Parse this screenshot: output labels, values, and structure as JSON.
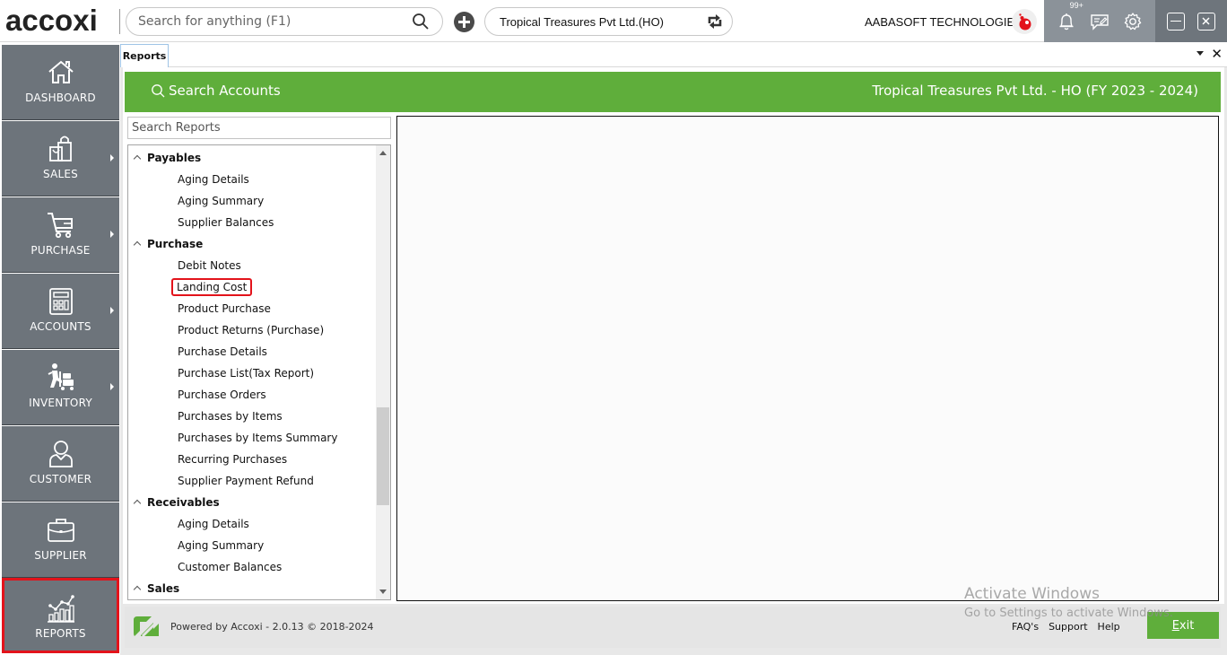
{
  "app": {
    "logo_text": "accoxi",
    "global_search": {
      "placeholder": "Search for anything (F1)",
      "value": ""
    },
    "company_selector": {
      "value": "Tropical Treasures Pvt Ltd.(HO)"
    },
    "organization": {
      "name": "AABASOFT TECHNOLOGIES"
    },
    "notifications": {
      "badge": "99+"
    }
  },
  "sidebar": {
    "items": [
      {
        "label": "DASHBOARD",
        "icon": "house-icon",
        "has_submenu": false,
        "selected": false
      },
      {
        "label": "SALES",
        "icon": "shopping-bags-icon",
        "has_submenu": true,
        "selected": false
      },
      {
        "label": "PURCHASE",
        "icon": "shopping-cart-icon",
        "has_submenu": true,
        "selected": false
      },
      {
        "label": "ACCOUNTS",
        "icon": "calculator-icon",
        "has_submenu": true,
        "selected": false
      },
      {
        "label": "INVENTORY",
        "icon": "person-with-trolley-icon",
        "has_submenu": true,
        "selected": false
      },
      {
        "label": "CUSTOMER",
        "icon": "person-icon",
        "has_submenu": false,
        "selected": false
      },
      {
        "label": "SUPPLIER",
        "icon": "briefcase-icon",
        "has_submenu": false,
        "selected": false
      },
      {
        "label": "REPORTS",
        "icon": "chart-icon",
        "has_submenu": false,
        "selected": true
      }
    ]
  },
  "tabs": [
    {
      "label": "Reports",
      "active": true
    }
  ],
  "header": {
    "search_accounts_label": "Search Accounts",
    "company_fy": "Tropical Treasures Pvt Ltd. - HO (FY 2023 - 2024)"
  },
  "reports": {
    "search": {
      "placeholder": "Search Reports",
      "value": ""
    },
    "tree": [
      {
        "type": "group",
        "label": "Payables"
      },
      {
        "type": "leaf",
        "label": "Aging Details"
      },
      {
        "type": "leaf",
        "label": "Aging Summary"
      },
      {
        "type": "leaf",
        "label": "Supplier Balances"
      },
      {
        "type": "group",
        "label": "Purchase"
      },
      {
        "type": "leaf",
        "label": "Debit Notes"
      },
      {
        "type": "leaf",
        "label": "Landing Cost",
        "highlighted": true
      },
      {
        "type": "leaf",
        "label": "Product Purchase"
      },
      {
        "type": "leaf",
        "label": "Product Returns (Purchase)"
      },
      {
        "type": "leaf",
        "label": "Purchase Details"
      },
      {
        "type": "leaf",
        "label": "Purchase List(Tax Report)"
      },
      {
        "type": "leaf",
        "label": "Purchase Orders"
      },
      {
        "type": "leaf",
        "label": "Purchases by Items"
      },
      {
        "type": "leaf",
        "label": "Purchases by Items Summary"
      },
      {
        "type": "leaf",
        "label": "Recurring Purchases"
      },
      {
        "type": "leaf",
        "label": "Supplier Payment Refund"
      },
      {
        "type": "group",
        "label": "Receivables"
      },
      {
        "type": "leaf",
        "label": "Aging Details"
      },
      {
        "type": "leaf",
        "label": "Aging Summary"
      },
      {
        "type": "leaf",
        "label": "Customer Balances"
      },
      {
        "type": "group",
        "label": "Sales"
      }
    ]
  },
  "footer": {
    "powered_by": "Powered by Accoxi - 2.0.13 © 2018-2024",
    "links": [
      "FAQ's",
      "Support",
      "Help"
    ],
    "exit_label_first": "E",
    "exit_label_rest": "xit"
  },
  "watermark": {
    "line1": "Activate Windows",
    "line2": "Go to Settings to activate Windows."
  },
  "colors": {
    "brand_green": "#5fae3b",
    "sidebar_bg": "#6d747b",
    "highlight_red": "#e3131b",
    "tools_bg": "#8b9299",
    "window_ctrl_bg": "#6e757c"
  }
}
